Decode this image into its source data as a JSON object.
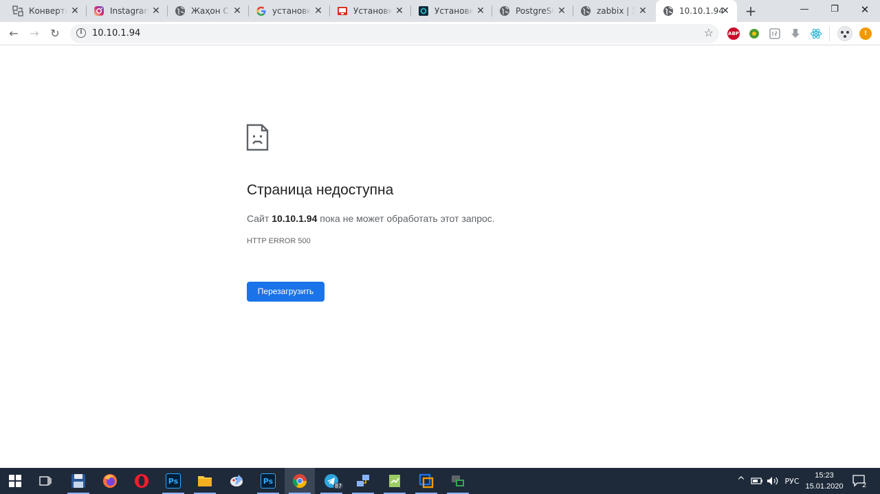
{
  "browser": {
    "tabs": [
      {
        "title": "Конвертер",
        "icon": "converter-favicon",
        "active": false
      },
      {
        "title": "Instagram",
        "icon": "instagram-favicon",
        "active": false
      },
      {
        "title": "Жаҳон Сог",
        "icon": "globe-favicon",
        "active": false
      },
      {
        "title": "установка",
        "icon": "google-favicon",
        "active": false
      },
      {
        "title": "Установка",
        "icon": "red-site-favicon",
        "active": false
      },
      {
        "title": "Установка",
        "icon": "dark-site-favicon",
        "active": false
      },
      {
        "title": "PostgreSQL",
        "icon": "globe-favicon",
        "active": false
      },
      {
        "title": "zabbix | Зап",
        "icon": "globe-favicon",
        "active": false
      },
      {
        "title": "10.10.1.94",
        "icon": "globe-favicon",
        "active": true
      }
    ],
    "new_tab_symbol": "+",
    "window_controls": {
      "minimize": "—",
      "restore": "❐",
      "close": "✕"
    },
    "toolbar": {
      "back": "←",
      "forward": "→",
      "reload": "↻",
      "url": "10.10.1.94",
      "info_symbol": "i",
      "bookmark_star": "☆"
    },
    "extensions": [
      {
        "name": "adblock-plus-extension",
        "label": "ABP",
        "color": "#c70d2c"
      },
      {
        "name": "green-extension",
        "label": "",
        "color": "#4a9a2e"
      },
      {
        "name": "script-extension",
        "label": "",
        "color": "#9aa0a6"
      },
      {
        "name": "download-extension",
        "label": "",
        "color": "#9aa0a6"
      },
      {
        "name": "react-devtools-extension",
        "label": "",
        "color": "#61dafb"
      },
      {
        "name": "profile-avatar",
        "label": "",
        "color": "#dadce0"
      },
      {
        "name": "update-alert",
        "label": "!",
        "color": "#f29900"
      }
    ]
  },
  "error_page": {
    "title": "Страница недоступна",
    "desc_prefix": "Сайт ",
    "desc_host": "10.10.1.94",
    "desc_suffix": " пока не может обработать этот запрос.",
    "code": "HTTP ERROR 500",
    "button": "Перезагрузить",
    "accent_color": "#1a73e8"
  },
  "taskbar": {
    "apps": [
      {
        "name": "start-button",
        "label": ""
      },
      {
        "name": "task-view-button",
        "label": ""
      },
      {
        "name": "save-app",
        "label": ""
      },
      {
        "name": "firefox-app",
        "label": ""
      },
      {
        "name": "opera-app",
        "label": ""
      },
      {
        "name": "photoshop-app",
        "label": "Ps"
      },
      {
        "name": "file-explorer-app",
        "label": ""
      },
      {
        "name": "paint-app",
        "label": ""
      },
      {
        "name": "photoshop-app-2",
        "label": "Ps"
      },
      {
        "name": "chrome-app",
        "label": ""
      },
      {
        "name": "telegram-app",
        "label": "87"
      },
      {
        "name": "network-app",
        "label": ""
      },
      {
        "name": "notepad-app",
        "label": ""
      },
      {
        "name": "virtualbox-app",
        "label": ""
      },
      {
        "name": "remote-app",
        "label": ""
      }
    ],
    "tray": {
      "chevron": "^",
      "language": "РУС",
      "time": "15:23",
      "date": "15.01.2020",
      "notifications": "2"
    }
  }
}
